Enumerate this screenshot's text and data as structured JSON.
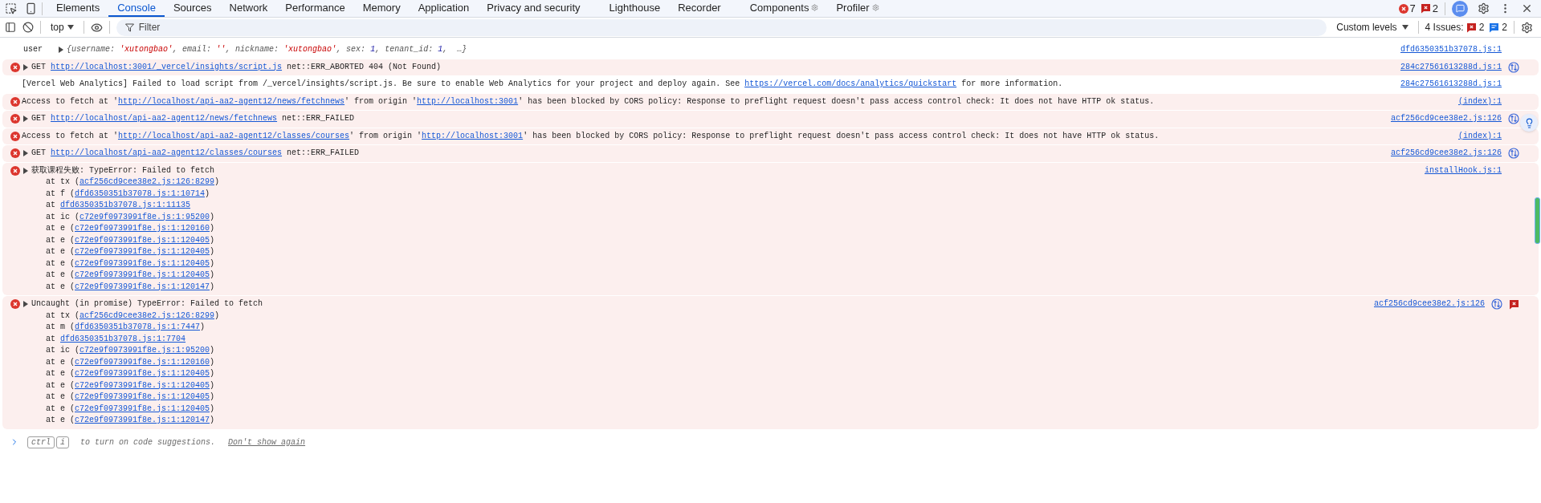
{
  "tabs": [
    {
      "label": "Elements",
      "selected": false,
      "extension": false
    },
    {
      "label": "Console",
      "selected": true,
      "extension": false
    },
    {
      "label": "Sources",
      "selected": false,
      "extension": false
    },
    {
      "label": "Network",
      "selected": false,
      "extension": false
    },
    {
      "label": "Performance",
      "selected": false,
      "extension": false
    },
    {
      "label": "Memory",
      "selected": false,
      "extension": false
    },
    {
      "label": "Application",
      "selected": false,
      "extension": false
    },
    {
      "label": "Privacy and security",
      "selected": false,
      "extension": false
    },
    {
      "label": "Lighthouse",
      "selected": false,
      "extension": false
    },
    {
      "label": "Recorder",
      "selected": false,
      "extension": false
    },
    {
      "label": "Components",
      "selected": false,
      "extension": true
    },
    {
      "label": "Profiler",
      "selected": false,
      "extension": true
    }
  ],
  "counts": {
    "errors": "7",
    "issues": "2"
  },
  "toolbar": {
    "context": "top",
    "filter_placeholder": "Filter",
    "levels": "Custom levels",
    "issues_label": "4 Issues:",
    "issue_errors": "2",
    "issue_info": "2"
  },
  "messages": [
    {
      "kind": "log",
      "label": "user",
      "expandable": true,
      "italic": true,
      "parts": [
        {
          "kind": "plain",
          "text": "{username: "
        },
        {
          "kind": "string",
          "text": "'xutongbao'"
        },
        {
          "kind": "plain",
          "text": ", email: "
        },
        {
          "kind": "string",
          "text": "''"
        },
        {
          "kind": "plain",
          "text": ", nickname: "
        },
        {
          "kind": "string",
          "text": "'xutongbao'"
        },
        {
          "kind": "plain",
          "text": ", sex: "
        },
        {
          "kind": "number",
          "text": "1"
        },
        {
          "kind": "plain",
          "text": ", tenant_id: "
        },
        {
          "kind": "number",
          "text": "1"
        },
        {
          "kind": "plain",
          "text": ",  …}"
        }
      ],
      "source": "dfd6350351b37078.js:1",
      "network": false,
      "issue": false
    },
    {
      "kind": "error",
      "expandable": true,
      "italic": false,
      "parts": [
        {
          "kind": "plain",
          "text": "GET "
        },
        {
          "kind": "link",
          "text": "http://localhost:3001/_vercel/insights/script.js"
        },
        {
          "kind": "plain",
          "text": " net::ERR_ABORTED 404 (Not Found)"
        }
      ],
      "source": "284c27561613288d.js:1",
      "network": true,
      "issue": false
    },
    {
      "kind": "info",
      "expandable": false,
      "italic": false,
      "parts": [
        {
          "kind": "plain",
          "text": "[Vercel Web Analytics] Failed to load script from /_vercel/insights/script.js. Be sure to enable Web Analytics for your project and deploy again. See "
        },
        {
          "kind": "link",
          "text": "https://vercel.com/docs/analytics/quickstart"
        },
        {
          "kind": "plain",
          "text": " for more information."
        }
      ],
      "source": "284c27561613288d.js:1",
      "network": false,
      "issue": false
    },
    {
      "kind": "error",
      "expandable": false,
      "italic": false,
      "parts": [
        {
          "kind": "plain",
          "text": "Access to fetch at '"
        },
        {
          "kind": "link",
          "text": "http://localhost/api-aa2-agent12/news/fetchnews"
        },
        {
          "kind": "plain",
          "text": "' from origin '"
        },
        {
          "kind": "link",
          "text": "http://localhost:3001"
        },
        {
          "kind": "plain",
          "text": "' has been blocked by CORS policy: Response to preflight request doesn't pass access control check: It does not have HTTP ok status."
        }
      ],
      "source": "(index):1",
      "network": false,
      "issue": false
    },
    {
      "kind": "error",
      "expandable": true,
      "italic": false,
      "parts": [
        {
          "kind": "plain",
          "text": "GET "
        },
        {
          "kind": "link",
          "text": "http://localhost/api-aa2-agent12/news/fetchnews"
        },
        {
          "kind": "plain",
          "text": " net::ERR_FAILED"
        }
      ],
      "source": "acf256cd9cee38e2.js:126",
      "network": true,
      "issue": false
    },
    {
      "kind": "error",
      "expandable": false,
      "italic": false,
      "parts": [
        {
          "kind": "plain",
          "text": "Access to fetch at '"
        },
        {
          "kind": "link",
          "text": "http://localhost/api-aa2-agent12/classes/courses"
        },
        {
          "kind": "plain",
          "text": "' from origin '"
        },
        {
          "kind": "link",
          "text": "http://localhost:3001"
        },
        {
          "kind": "plain",
          "text": "' has been blocked by CORS policy: Response to preflight request doesn't pass access control check: It does not have HTTP ok status."
        }
      ],
      "source": "(index):1",
      "network": false,
      "issue": false
    },
    {
      "kind": "error",
      "expandable": true,
      "italic": false,
      "parts": [
        {
          "kind": "plain",
          "text": "GET "
        },
        {
          "kind": "link",
          "text": "http://localhost/api-aa2-agent12/classes/courses"
        },
        {
          "kind": "plain",
          "text": " net::ERR_FAILED"
        }
      ],
      "source": "acf256cd9cee38e2.js:126",
      "network": true,
      "issue": false
    },
    {
      "kind": "error",
      "expandable": true,
      "italic": false,
      "parts": [
        {
          "kind": "plain",
          "text": "获取课程失败: TypeError: Failed to fetch"
        }
      ],
      "frames": [
        {
          "before": "at tx (",
          "link": "acf256cd9cee38e2.js:126:8299",
          "after": ")"
        },
        {
          "before": "at f (",
          "link": "dfd6350351b37078.js:1:10714",
          "after": ")"
        },
        {
          "before": "at ",
          "link": "dfd6350351b37078.js:1:11135"
        },
        {
          "before": "at ic (",
          "link": "c72e9f0973991f8e.js:1:95200",
          "after": ")"
        },
        {
          "before": "at e (",
          "link": "c72e9f0973991f8e.js:1:120160",
          "after": ")"
        },
        {
          "before": "at e (",
          "link": "c72e9f0973991f8e.js:1:120405",
          "after": ")"
        },
        {
          "before": "at e (",
          "link": "c72e9f0973991f8e.js:1:120405",
          "after": ")"
        },
        {
          "before": "at e (",
          "link": "c72e9f0973991f8e.js:1:120405",
          "after": ")"
        },
        {
          "before": "at e (",
          "link": "c72e9f0973991f8e.js:1:120405",
          "after": ")"
        },
        {
          "before": "at e (",
          "link": "c72e9f0973991f8e.js:1:120147",
          "after": ")"
        }
      ],
      "source": "installHook.js:1",
      "network": false,
      "issue": false
    },
    {
      "kind": "error",
      "expandable": true,
      "italic": false,
      "parts": [
        {
          "kind": "plain",
          "text": "Uncaught (in promise) TypeError: Failed to fetch"
        }
      ],
      "frames": [
        {
          "before": "at tx (",
          "link": "acf256cd9cee38e2.js:126:8299",
          "after": ")"
        },
        {
          "before": "at m (",
          "link": "dfd6350351b37078.js:1:7447",
          "after": ")"
        },
        {
          "before": "at ",
          "link": "dfd6350351b37078.js:1:7704"
        },
        {
          "before": "at ic (",
          "link": "c72e9f0973991f8e.js:1:95200",
          "after": ")"
        },
        {
          "before": "at e (",
          "link": "c72e9f0973991f8e.js:1:120160",
          "after": ")"
        },
        {
          "before": "at e (",
          "link": "c72e9f0973991f8e.js:1:120405",
          "after": ")"
        },
        {
          "before": "at e (",
          "link": "c72e9f0973991f8e.js:1:120405",
          "after": ")"
        },
        {
          "before": "at e (",
          "link": "c72e9f0973991f8e.js:1:120405",
          "after": ")"
        },
        {
          "before": "at e (",
          "link": "c72e9f0973991f8e.js:1:120405",
          "after": ")"
        },
        {
          "before": "at e (",
          "link": "c72e9f0973991f8e.js:1:120147",
          "after": ")"
        }
      ],
      "source": "acf256cd9cee38e2.js:126",
      "network": true,
      "issue": true
    }
  ],
  "prompt_hint": {
    "keys": [
      "ctrl",
      "i"
    ],
    "text": "to turn on code suggestions.",
    "link": "Don't show again"
  }
}
